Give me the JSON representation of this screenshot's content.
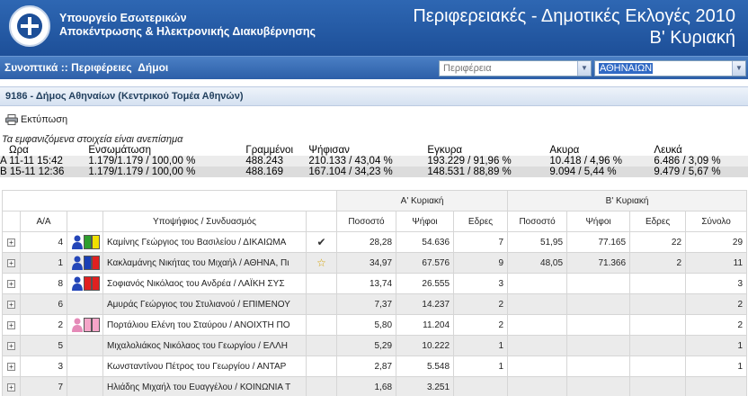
{
  "header": {
    "ministry_line1": "Υπουργείο Εσωτερικών",
    "ministry_line2": "Αποκέντρωσης & Ηλεκτρονικής Διακυβέρνησης",
    "title_line1": "Περιφερειακές - Δημοτικές Εκλογές 2010",
    "title_line2": "Β' Κυριακή"
  },
  "nav": {
    "link_summary": "Συνοπτικά",
    "sep": " :: ",
    "link_regions": "Περιφέρειες",
    "link_municipalities": "Δήμοι",
    "region_select": "Περιφέρεια",
    "municipality_select": "ΑΘΗΝΑΙΩΝ"
  },
  "section": {
    "title": "9186 - Δήμος Αθηναίων (Κεντρικού Τομέα Αθηνών)"
  },
  "print": {
    "label": "Εκτύπωση"
  },
  "summary": {
    "note": "Τα εμφανιζόμενα στοιχεία είναι ανεπίσημα",
    "headers": [
      "Ωρα",
      "Ενσωμάτωση",
      "Γραμμένοι",
      "Ψήφισαν",
      "Εγκυρα",
      "Ακυρα",
      "Λευκά"
    ],
    "rows": [
      [
        "A 11-11 15:42",
        "1.179/1.179 / 100,00 %",
        "488.243",
        "210.133 / 43,04 %",
        "193.229 / 91,96 %",
        "10.418 / 4,96 %",
        "6.486 / 3,09 %"
      ],
      [
        "B 15-11 12:36",
        "1.179/1.179 / 100,00 %",
        "488.169",
        "167.104 / 34,23 %",
        "148.531 / 88,89 %",
        "9.094 / 5,44 %",
        "9.479 / 5,67 %"
      ]
    ]
  },
  "results": {
    "round_a": "Α' Κυριακή",
    "round_b": "Β' Κυριακή",
    "col_aa": "Α/Α",
    "col_candidate": "Υποψήφιος / Συνδυασμός",
    "col_pct": "Ποσοστό",
    "col_votes": "Ψήφοι",
    "col_seats": "Εδρες",
    "col_total": "Σύνολο",
    "rows": [
      {
        "aa": "4",
        "name": "Καμίνης Γεώργιος του Βασιλείου / ΔΙΚΑΙΩΜΑ",
        "mark": "✔",
        "a_pct": "28,28",
        "a_votes": "54.636",
        "a_seats": "7",
        "b_pct": "51,95",
        "b_votes": "77.165",
        "b_seats": "22",
        "total": "29",
        "icon": "person-blue",
        "colors": [
          "#2e9e2e",
          "#f0e000"
        ]
      },
      {
        "aa": "1",
        "name": "Κακλαμάνης Νικήτας του Μιχαήλ / ΑΘΗΝΑ, Πι",
        "mark": "☆",
        "a_pct": "34,97",
        "a_votes": "67.576",
        "a_seats": "9",
        "b_pct": "48,05",
        "b_votes": "71.366",
        "b_seats": "2",
        "total": "11",
        "icon": "person-blue",
        "colors": [
          "#1a3fb5",
          "#e02020"
        ]
      },
      {
        "aa": "8",
        "name": "Σοφιανός Νικόλαος του Ανδρέα / ΛΑΪΚΗ ΣΥΣ",
        "mark": "",
        "a_pct": "13,74",
        "a_votes": "26.555",
        "a_seats": "3",
        "b_pct": "",
        "b_votes": "",
        "b_seats": "",
        "total": "3",
        "icon": "person-blue",
        "colors": [
          "#e02020",
          "#e02020"
        ]
      },
      {
        "aa": "6",
        "name": "Αμυράς Γεώργιος του Στυλιανού / ΕΠΙΜΕΝΟΥ",
        "mark": "",
        "a_pct": "7,37",
        "a_votes": "14.237",
        "a_seats": "2",
        "b_pct": "",
        "b_votes": "",
        "b_seats": "",
        "total": "2",
        "icon": "",
        "colors": []
      },
      {
        "aa": "2",
        "name": "Πορτάλιου Ελένη του Σταύρου / ΑΝΟΙΧΤΗ ΠΟ",
        "mark": "",
        "a_pct": "5,80",
        "a_votes": "11.204",
        "a_seats": "2",
        "b_pct": "",
        "b_votes": "",
        "b_seats": "",
        "total": "2",
        "icon": "person-pink",
        "colors": [
          "#f5a5c8",
          "#f5a5c8"
        ]
      },
      {
        "aa": "5",
        "name": "Μιχαλολιάκος Νικόλαος του Γεωργίου / ΕΛΛΗ",
        "mark": "",
        "a_pct": "5,29",
        "a_votes": "10.222",
        "a_seats": "1",
        "b_pct": "",
        "b_votes": "",
        "b_seats": "",
        "total": "1",
        "icon": "",
        "colors": []
      },
      {
        "aa": "3",
        "name": "Κωνσταντίνου Πέτρος του Γεωργίου / ΑΝΤΑΡ",
        "mark": "",
        "a_pct": "2,87",
        "a_votes": "5.548",
        "a_seats": "1",
        "b_pct": "",
        "b_votes": "",
        "b_seats": "",
        "total": "1",
        "icon": "",
        "colors": []
      },
      {
        "aa": "7",
        "name": "Ηλιάδης Μιχαήλ του Ευαγγέλου / ΚΟΙΝΩΝΙΑ Τ",
        "mark": "",
        "a_pct": "1,68",
        "a_votes": "3.251",
        "a_seats": "",
        "b_pct": "",
        "b_votes": "",
        "b_seats": "",
        "total": "",
        "icon": "",
        "colors": []
      }
    ]
  }
}
